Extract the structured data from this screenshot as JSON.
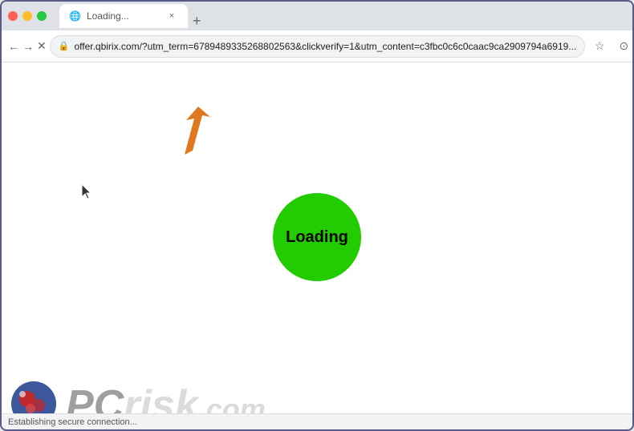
{
  "browser": {
    "tab": {
      "title": "Loading...",
      "favicon": "🌐",
      "close_label": "×"
    },
    "new_tab_label": "+",
    "nav": {
      "back_label": "←",
      "forward_label": "→",
      "reload_label": "✕",
      "url": "offer.qbirix.com/?utm_term=6789489335268802563&clickverify=1&utm_content=c3fbc0c6c0caac9ca2909794a6919...",
      "bookmark_label": "☆",
      "account_label": "⊙",
      "menu_label": "⋮"
    }
  },
  "page": {
    "loading_text": "Loading",
    "status_text": "Establishing secure connection..."
  },
  "colors": {
    "loading_circle": "#22cc00",
    "arrow": "#e07820"
  }
}
